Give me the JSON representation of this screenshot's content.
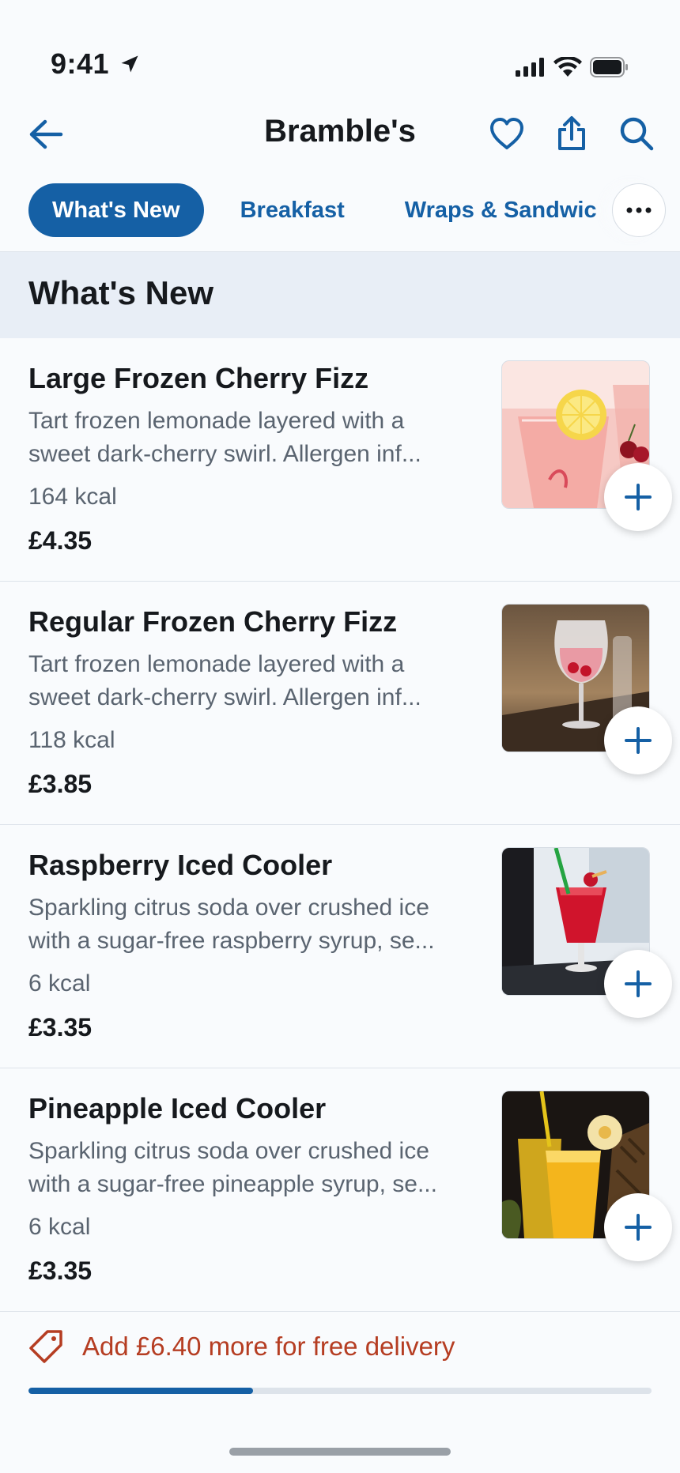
{
  "status_bar": {
    "time": "9:41"
  },
  "header": {
    "title": "Bramble's",
    "back_icon": "arrow-left-icon",
    "actions": [
      "heart-icon",
      "share-icon",
      "search-icon"
    ]
  },
  "tabs": [
    {
      "label": "What's New",
      "active": true
    },
    {
      "label": "Breakfast",
      "active": false
    },
    {
      "label": "Wraps & Sandwic",
      "active": false
    }
  ],
  "section": {
    "title": "What's New"
  },
  "items": [
    {
      "name": "Large Frozen Cherry Fizz",
      "description": "Tart frozen lemonade layered with a sweet dark-cherry swirl. Allergen inf...",
      "kcal": "164 kcal",
      "price": "£4.35"
    },
    {
      "name": "Regular Frozen Cherry Fizz",
      "description": "Tart frozen lemonade layered with a sweet dark-cherry swirl. Allergen inf...",
      "kcal": "118 kcal",
      "price": "£3.85"
    },
    {
      "name": "Raspberry Iced Cooler",
      "description": "Sparkling citrus soda over crushed ice with a sugar-free raspberry syrup, se...",
      "kcal": "6 kcal",
      "price": "£3.35"
    },
    {
      "name": "Pineapple Iced Cooler",
      "description": "Sparkling citrus soda over crushed ice with a sugar-free pineapple syrup, se...",
      "kcal": "6 kcal",
      "price": "£3.35"
    }
  ],
  "delivery": {
    "message": "Add £6.40 more for free delivery",
    "icon": "tag-icon",
    "progress": 0.36
  },
  "colors": {
    "accent": "#1560a5",
    "warning_text": "#b53d22",
    "section_bg": "#e8eef6"
  }
}
